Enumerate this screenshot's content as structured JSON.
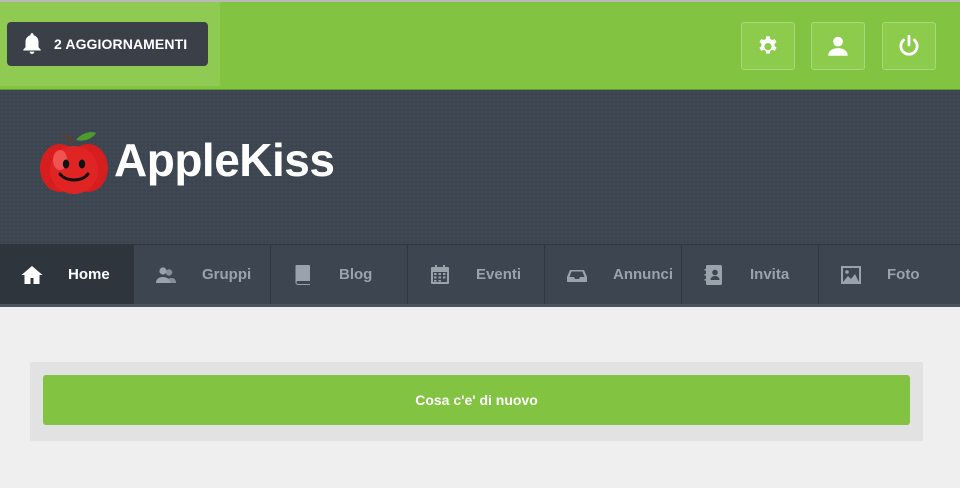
{
  "topbar": {
    "notifications_label": "2 AGGIORNAMENTI",
    "icons": [
      "bell-icon",
      "gear-icon",
      "user-icon",
      "power-icon"
    ]
  },
  "header": {
    "brand": "AppleKiss"
  },
  "nav": {
    "items": [
      {
        "label": "Home",
        "icon": "home-icon",
        "active": true
      },
      {
        "label": "Gruppi",
        "icon": "group-icon",
        "active": false
      },
      {
        "label": "Blog",
        "icon": "book-icon",
        "active": false
      },
      {
        "label": "Eventi",
        "icon": "calendar-icon",
        "active": false
      },
      {
        "label": "Annunci",
        "icon": "inbox-icon",
        "active": false
      },
      {
        "label": "Invita",
        "icon": "address-book-icon",
        "active": false
      },
      {
        "label": "Foto",
        "icon": "picture-icon",
        "active": false
      }
    ]
  },
  "main": {
    "whats_new_label": "Cosa c'e' di nuovo"
  },
  "colors": {
    "accent_green": "#82c341",
    "header_dark": "#3d4650",
    "background": "#efefef"
  }
}
